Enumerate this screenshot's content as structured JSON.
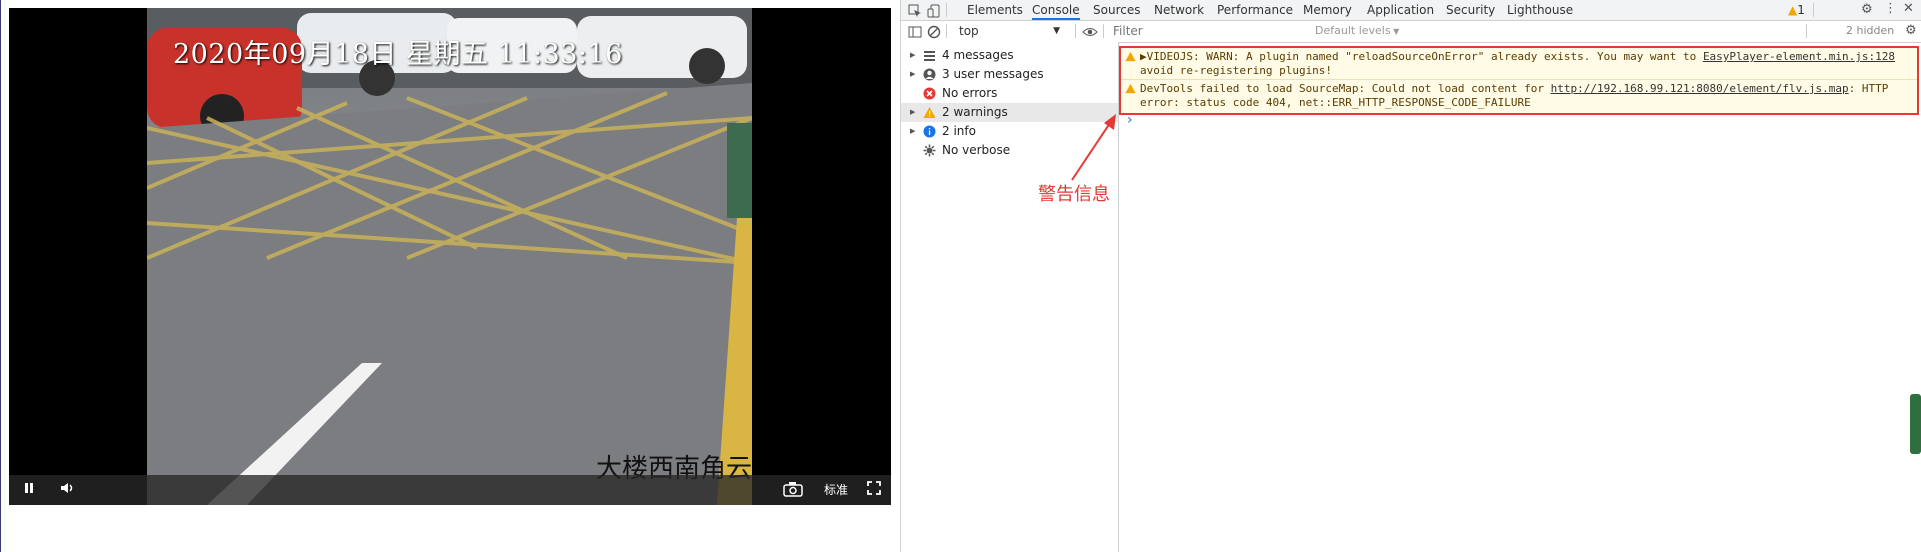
{
  "video": {
    "timestamp_osd": "2020年09月18日  星期五  11:33:16",
    "location_osd": "大楼西南角云",
    "quality_label": "标准",
    "controls": [
      "pause",
      "volume",
      "snapshot",
      "quality",
      "fullscreen"
    ]
  },
  "devtools": {
    "tabs": [
      {
        "label": "Elements",
        "active": false
      },
      {
        "label": "Console",
        "active": true
      },
      {
        "label": "Sources",
        "active": false
      },
      {
        "label": "Network",
        "active": false
      },
      {
        "label": "Performance",
        "active": false
      },
      {
        "label": "Memory",
        "active": false
      },
      {
        "label": "Application",
        "active": false
      },
      {
        "label": "Security",
        "active": false
      },
      {
        "label": "Lighthouse",
        "active": false
      }
    ],
    "warning_count": "1",
    "toolbar": {
      "context": "top",
      "filter_placeholder": "Filter",
      "levels": "Default levels",
      "hidden": "2 hidden"
    },
    "sidebar": [
      {
        "label": "4 messages",
        "icon": "list-icon",
        "expandable": true
      },
      {
        "label": "3 user messages",
        "icon": "user-icon",
        "expandable": true
      },
      {
        "label": "No errors",
        "icon": "error-icon",
        "expandable": false
      },
      {
        "label": "2 warnings",
        "icon": "warning-icon",
        "expandable": true,
        "selected": true
      },
      {
        "label": "2 info",
        "icon": "info-icon",
        "expandable": true
      },
      {
        "label": "No verbose",
        "icon": "verbose-icon",
        "expandable": false
      }
    ],
    "messages": [
      {
        "line1": "▶VIDEOJS: WARN: A plugin named \"reloadSourceOnError\" already exists. You may want to",
        "line2": "avoid re-registering plugins!",
        "source": "EasyPlayer-element.min.js:128"
      },
      {
        "line1_prefix": "DevTools failed to load SourceMap: Could not load content for ",
        "url": "http://192.168.99.121:8080/element/flv.js.map",
        "line1_suffix": ": HTTP",
        "line2": "error: status code 404, net::ERR_HTTP_RESPONSE_CODE_FAILURE"
      }
    ],
    "prompt": "›"
  },
  "annotation": {
    "label": "警告信息",
    "color": "#e53935"
  },
  "colors": {
    "warning_bg": "#fffbe6",
    "warning_text": "#5c3c00",
    "highlight_border": "#e53935",
    "active_tab": "#1a73e8"
  }
}
